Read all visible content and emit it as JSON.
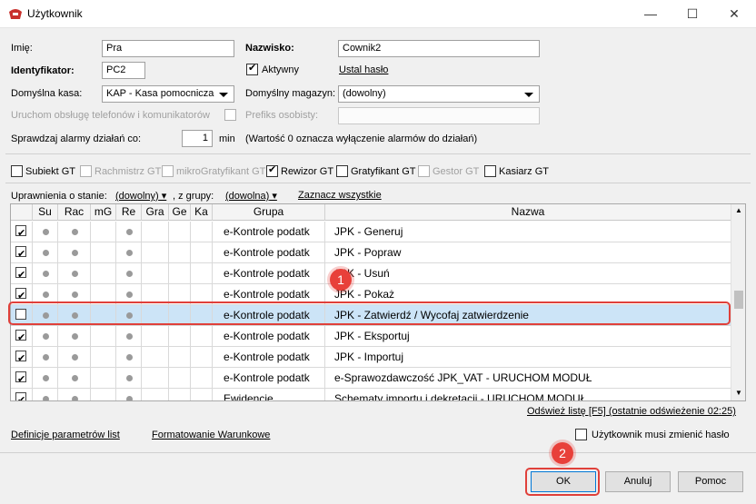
{
  "window": {
    "title": "Użytkownik",
    "minimize": "—",
    "maximize": "☐",
    "close": "✕"
  },
  "form": {
    "first_name_label": "Imię:",
    "first_name_value": "Pra",
    "last_name_label": "Nazwisko:",
    "last_name_value": "Cownik2",
    "identifier_label": "Identyfikator:",
    "identifier_value": "PC2",
    "active_label": "Aktywny",
    "set_password_link": "Ustal hasło",
    "default_cash_label": "Domyślna kasa:",
    "default_cash_value": "KAP - Kasa pomocnicza",
    "default_warehouse_label": "Domyślny magazyn:",
    "default_warehouse_value": "(dowolny)",
    "phone_service_label": "Uruchom obsługę telefonów i komunikatorów",
    "personal_prefix_label": "Prefiks osobisty:",
    "alarm_check_label": "Sprawdzaj alarmy działań co:",
    "alarm_value": "1",
    "alarm_unit": "min",
    "alarm_hint": "(Wartość 0 oznacza wyłączenie alarmów do działań)"
  },
  "modules": [
    {
      "label": "Subiekt GT",
      "checked": false,
      "disabled": false
    },
    {
      "label": "Rachmistrz GT",
      "checked": false,
      "disabled": true
    },
    {
      "label": "mikroGratyfikant GT",
      "checked": false,
      "disabled": true
    },
    {
      "label": "Rewizor GT",
      "checked": true,
      "disabled": false
    },
    {
      "label": "Gratyfikant GT",
      "checked": false,
      "disabled": false
    },
    {
      "label": "Gestor GT",
      "checked": false,
      "disabled": true
    },
    {
      "label": "Kasiarz GT",
      "checked": false,
      "disabled": false
    }
  ],
  "filter": {
    "state_label": "Uprawnienia o stanie:",
    "state_value": "(dowolny)",
    "group_label": ", z grupy:",
    "group_value": "(dowolna)",
    "select_all_link": "Zaznacz wszystkie"
  },
  "grid": {
    "columns": [
      "",
      "Su",
      "Rac",
      "mG",
      "Re",
      "Gra",
      "Ge",
      "Ka",
      "Grupa",
      "Nazwa"
    ],
    "rows": [
      {
        "checked": true,
        "grupa": "e-Kontrole podatk",
        "nazwa": "JPK - Generuj"
      },
      {
        "checked": true,
        "grupa": "e-Kontrole podatk",
        "nazwa": "JPK - Popraw"
      },
      {
        "checked": true,
        "grupa": "e-Kontrole podatk",
        "nazwa": "JPK - Usuń"
      },
      {
        "checked": true,
        "grupa": "e-Kontrole podatk",
        "nazwa": "JPK - Pokaż"
      },
      {
        "checked": false,
        "grupa": "e-Kontrole podatk",
        "nazwa": "JPK - Zatwierdź / Wycofaj zatwierdzenie",
        "selected": true
      },
      {
        "checked": true,
        "grupa": "e-Kontrole podatk",
        "nazwa": "JPK - Eksportuj"
      },
      {
        "checked": true,
        "grupa": "e-Kontrole podatk",
        "nazwa": "JPK - Importuj"
      },
      {
        "checked": true,
        "grupa": "e-Kontrole podatk",
        "nazwa": "e-Sprawozdawczość JPK_VAT - URUCHOM MODUŁ"
      },
      {
        "checked": true,
        "grupa": "Ewidencje",
        "nazwa": "Schematy importu i dekretacji - URUCHOM MODUŁ"
      }
    ]
  },
  "refresh_link": "Odśwież listę [F5] (ostatnie odświeżenie 02:25)",
  "bottom": {
    "list_params_link": "Definicje parametrów list",
    "conditional_format_link": "Formatowanie Warunkowe",
    "must_change_password_label": "Użytkownik musi zmienić hasło"
  },
  "buttons": {
    "ok": "OK",
    "cancel": "Anuluj",
    "help": "Pomoc"
  },
  "annotations": {
    "badge1": "1",
    "badge2": "2"
  },
  "colors": {
    "annotation": "#e0403a",
    "selection": "#cce4f7"
  }
}
